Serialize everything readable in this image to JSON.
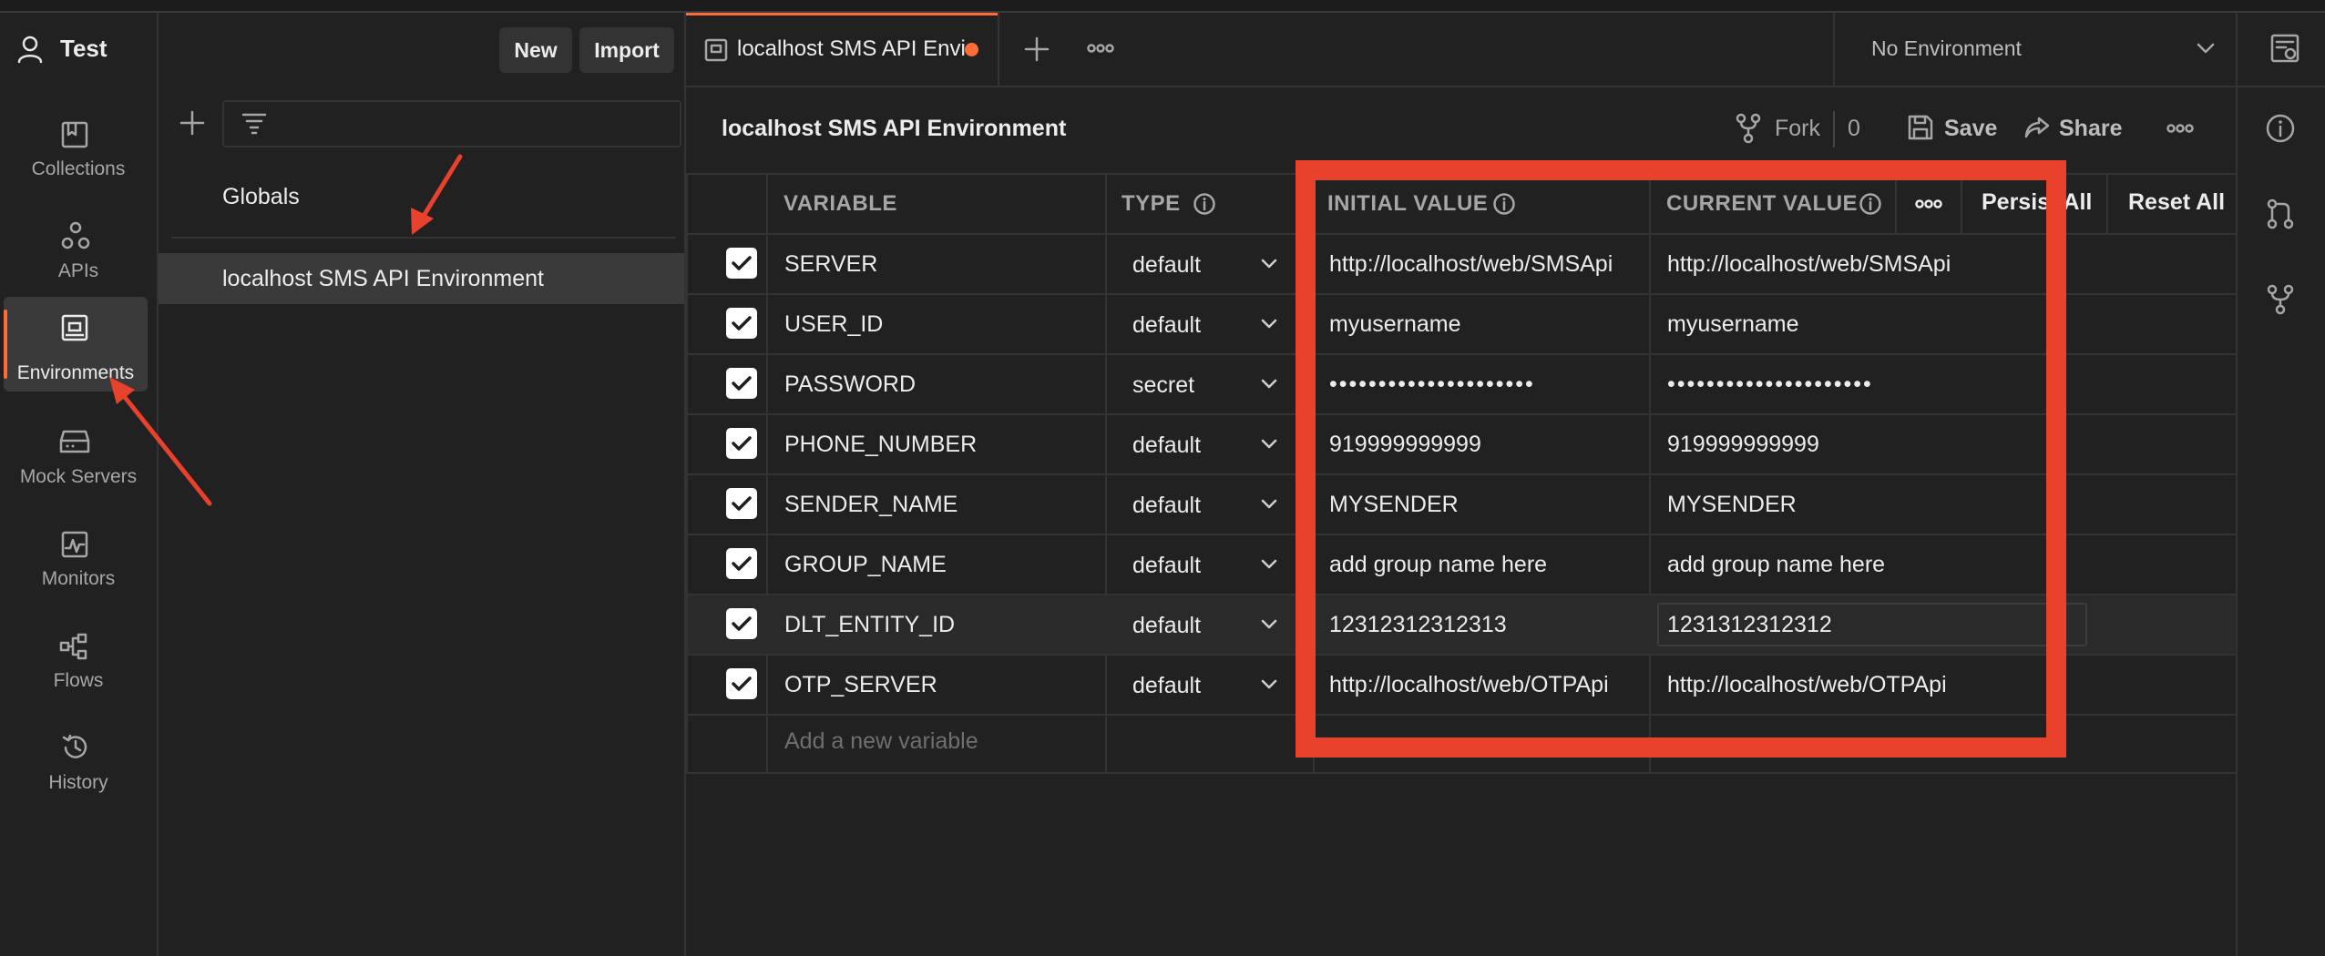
{
  "workspace": {
    "name": "Test",
    "new_label": "New",
    "import_label": "Import"
  },
  "sidebar": {
    "items": [
      {
        "label": "Collections",
        "icon": "collections-icon"
      },
      {
        "label": "APIs",
        "icon": "apis-icon"
      },
      {
        "label": "Environments",
        "icon": "environments-icon",
        "active": true
      },
      {
        "label": "Mock Servers",
        "icon": "mock-servers-icon"
      },
      {
        "label": "Monitors",
        "icon": "monitors-icon"
      },
      {
        "label": "Flows",
        "icon": "flows-icon"
      },
      {
        "label": "History",
        "icon": "history-icon"
      }
    ]
  },
  "env_list": {
    "search_placeholder": "",
    "globals_label": "Globals",
    "environments": [
      "localhost SMS API Environment"
    ]
  },
  "tabs": [
    {
      "label": "localhost SMS API Envi",
      "unsaved": true
    }
  ],
  "env_selector": {
    "value": "No Environment"
  },
  "editor": {
    "title": "localhost SMS API Environment",
    "fork_label": "Fork",
    "fork_count": "0",
    "save_label": "Save",
    "share_label": "Share",
    "columns": {
      "variable": "VARIABLE",
      "type": "TYPE",
      "initial": "INITIAL VALUE",
      "current": "CURRENT VALUE",
      "persist_all": "Persist All",
      "reset_all": "Reset All"
    },
    "rows": [
      {
        "name": "SERVER",
        "type": "default",
        "initial": "http://localhost/web/SMSApi",
        "current": "http://localhost/web/SMSApi"
      },
      {
        "name": "USER_ID",
        "type": "default",
        "initial": "myusername",
        "current": "myusername"
      },
      {
        "name": "PASSWORD",
        "type": "secret",
        "initial": "•••••••••••••••••••••",
        "current": "•••••••••••••••••••••"
      },
      {
        "name": "PHONE_NUMBER",
        "type": "default",
        "initial": "919999999999",
        "current": "919999999999"
      },
      {
        "name": "SENDER_NAME",
        "type": "default",
        "initial": "MYSENDER",
        "current": "MYSENDER"
      },
      {
        "name": "GROUP_NAME",
        "type": "default",
        "initial": "add group name here",
        "current": "add group name here"
      },
      {
        "name": "DLT_ENTITY_ID",
        "type": "default",
        "initial": "12312312312313",
        "current": "1231312312312"
      },
      {
        "name": "OTP_SERVER",
        "type": "default",
        "initial": "http://localhost/web/OTPApi",
        "current": "http://localhost/web/OTPApi"
      }
    ],
    "add_placeholder": "Add a new variable"
  },
  "colors": {
    "accent": "#ff6c37",
    "annotation": "#e8412c",
    "background": "#212121"
  }
}
